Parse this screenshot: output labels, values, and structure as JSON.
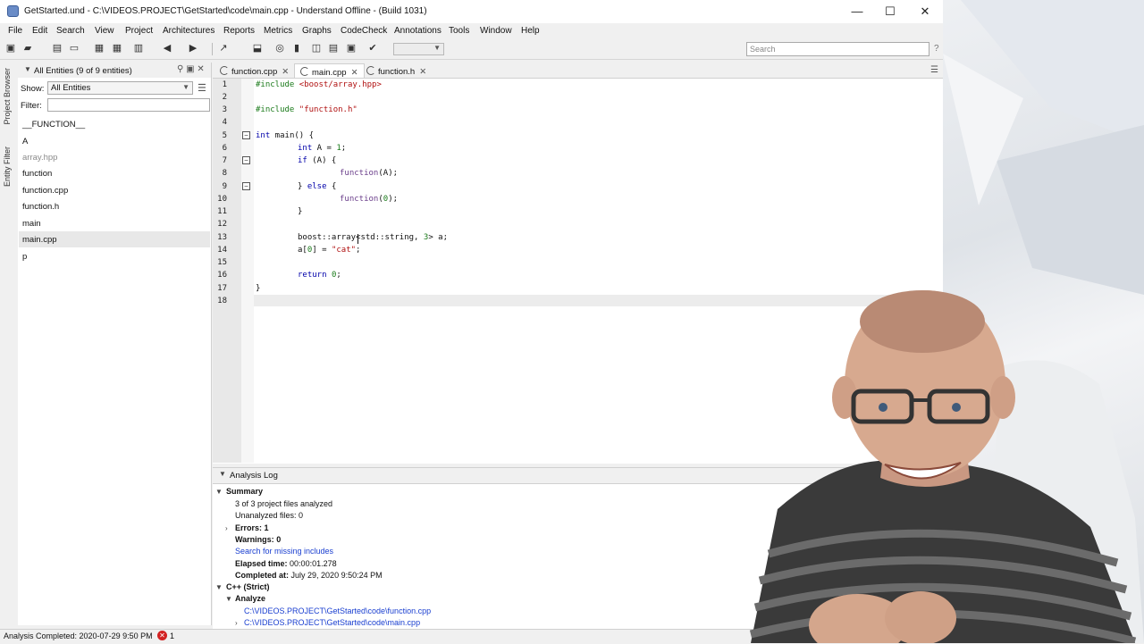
{
  "window": {
    "title": "GetStarted.und - C:\\VIDEOS.PROJECT\\GetStarted\\code\\main.cpp - Understand Offline - (Build 1031)",
    "minimize": "—",
    "maximize": "☐",
    "close": "✕"
  },
  "menu": [
    "File",
    "Edit",
    "Search",
    "View",
    "Project",
    "Architectures",
    "Reports",
    "Metrics",
    "Graphs",
    "CodeCheck",
    "Annotations",
    "Tools",
    "Window",
    "Help"
  ],
  "toolbar": {
    "search_placeholder": "Search",
    "help": "?"
  },
  "vtabs": [
    "Project Browser",
    "Entity Filter"
  ],
  "entities": {
    "title": "All Entities (9 of 9 entities)",
    "show_label": "Show:",
    "show_value": "All Entities",
    "filter_label": "Filter:",
    "items": [
      "__FUNCTION__",
      "A",
      "array.hpp",
      "function",
      "function.cpp",
      "function.h",
      "main",
      "main.cpp",
      "p"
    ],
    "selected": "main.cpp"
  },
  "tabs": [
    {
      "label": "function.cpp"
    },
    {
      "label": "main.cpp"
    },
    {
      "label": "function.h"
    }
  ],
  "code": {
    "line_numbers": [
      "1",
      "2",
      "3",
      "4",
      "5",
      "6",
      "7",
      "8",
      "9",
      "10",
      "11",
      "12",
      "13",
      "14",
      "15",
      "16",
      "17",
      "18"
    ],
    "l1_kw": "#include",
    "l1_str": "<boost/array.hpp>",
    "l3_kw": "#include",
    "l3_str": "\"function.h\"",
    "l5_kw": "int",
    "l5_rest": " main() {",
    "l6_kw": "int",
    "l6_rest": " A = ",
    "l6_num": "1",
    "l6_end": ";",
    "l7_kw": "if",
    "l7_rest": " (A) {",
    "l8_fn": "function",
    "l8_rest": "(A);",
    "l9_a": "} ",
    "l9_kw": "else",
    "l9_b": " {",
    "l10_fn": "function",
    "l10_a": "(",
    "l10_num": "0",
    "l10_b": ");",
    "l11": "}",
    "l13_a": "boost::array<std::string, ",
    "l13_num": "3",
    "l13_b": "> a;",
    "l14_a": "a[",
    "l14_num": "0",
    "l14_b": "] = ",
    "l14_str": "\"cat\"",
    "l14_c": ";",
    "l16_kw": "return",
    "l16_sp": " ",
    "l16_num": "0",
    "l16_end": ";",
    "l17": "}"
  },
  "log": {
    "title": "Analysis Log",
    "summary": "Summary",
    "analyzed": "3 of 3 project files analyzed",
    "unanalyzed": "Unanalyzed files: 0",
    "errors_label": "Errors:",
    "errors_value": "1",
    "warnings_label": "Warnings:",
    "warnings_value": "0",
    "search_missing": "Search for missing includes",
    "elapsed_label": "Elapsed time:",
    "elapsed_value": "00:00:01.278",
    "completed_label": "Completed at:",
    "completed_value": "July 29, 2020 9:50:24 PM",
    "cpp": "C++ (Strict)",
    "analyze": "Analyze",
    "file1": "C:\\VIDEOS.PROJECT\\GetStarted\\code\\function.cpp",
    "file2": "C:\\VIDEOS.PROJECT\\GetStarted\\code\\main.cpp"
  },
  "status": {
    "text": "Analysis Completed: 2020-07-29 9:50 PM",
    "error_count": "1"
  }
}
